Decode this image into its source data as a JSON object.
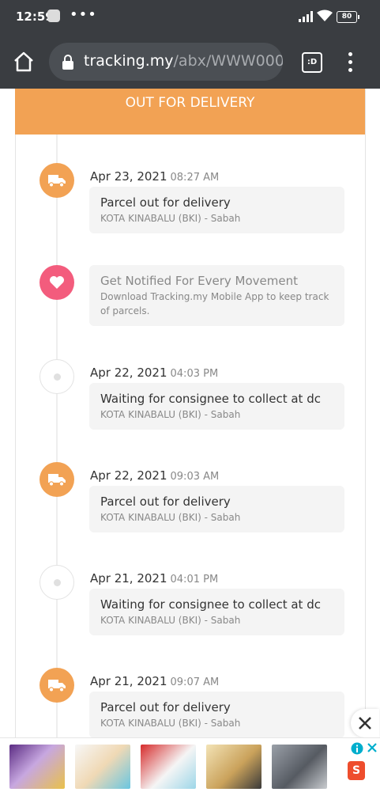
{
  "status_bar": {
    "time": "12:59",
    "dots": "•••",
    "battery": "80"
  },
  "browser": {
    "url_host": "tracking.my",
    "url_path": "/abx/WWW000",
    "tab_label": ":D"
  },
  "banner": {
    "title": "OUT FOR DELIVERY"
  },
  "events": [
    {
      "date": "Apr 23, 2021",
      "time": "08:27 AM",
      "title": "Parcel out for delivery",
      "location": "KOTA KINABALU (BKI) - Sabah",
      "icon": "truck-icon"
    },
    {
      "promo": true,
      "title": "Get Notified For Every Movement",
      "location": "Download Tracking.my Mobile App to keep track of parcels.",
      "icon": "heart-icon"
    },
    {
      "date": "Apr 22, 2021",
      "time": "04:03 PM",
      "title": "Waiting for consignee to collect at dc",
      "location": "KOTA KINABALU (BKI) - Sabah",
      "icon": "dot-icon"
    },
    {
      "date": "Apr 22, 2021",
      "time": "09:03 AM",
      "title": "Parcel out for delivery",
      "location": "KOTA KINABALU (BKI) - Sabah",
      "icon": "truck-icon"
    },
    {
      "date": "Apr 21, 2021",
      "time": "04:01 PM",
      "title": "Waiting for consignee to collect at dc",
      "location": "KOTA KINABALU (BKI) - Sabah",
      "icon": "dot-icon"
    },
    {
      "date": "Apr 21, 2021",
      "time": "09:07 AM",
      "title": "Parcel out for delivery",
      "location": "KOTA KINABALU (BKI) - Sabah",
      "icon": "truck-icon"
    }
  ],
  "ad": {
    "shop_letter": "S"
  },
  "colors": {
    "accent": "#f2a254",
    "promo": "#f35c7d",
    "chrome": "#3a3d41"
  }
}
